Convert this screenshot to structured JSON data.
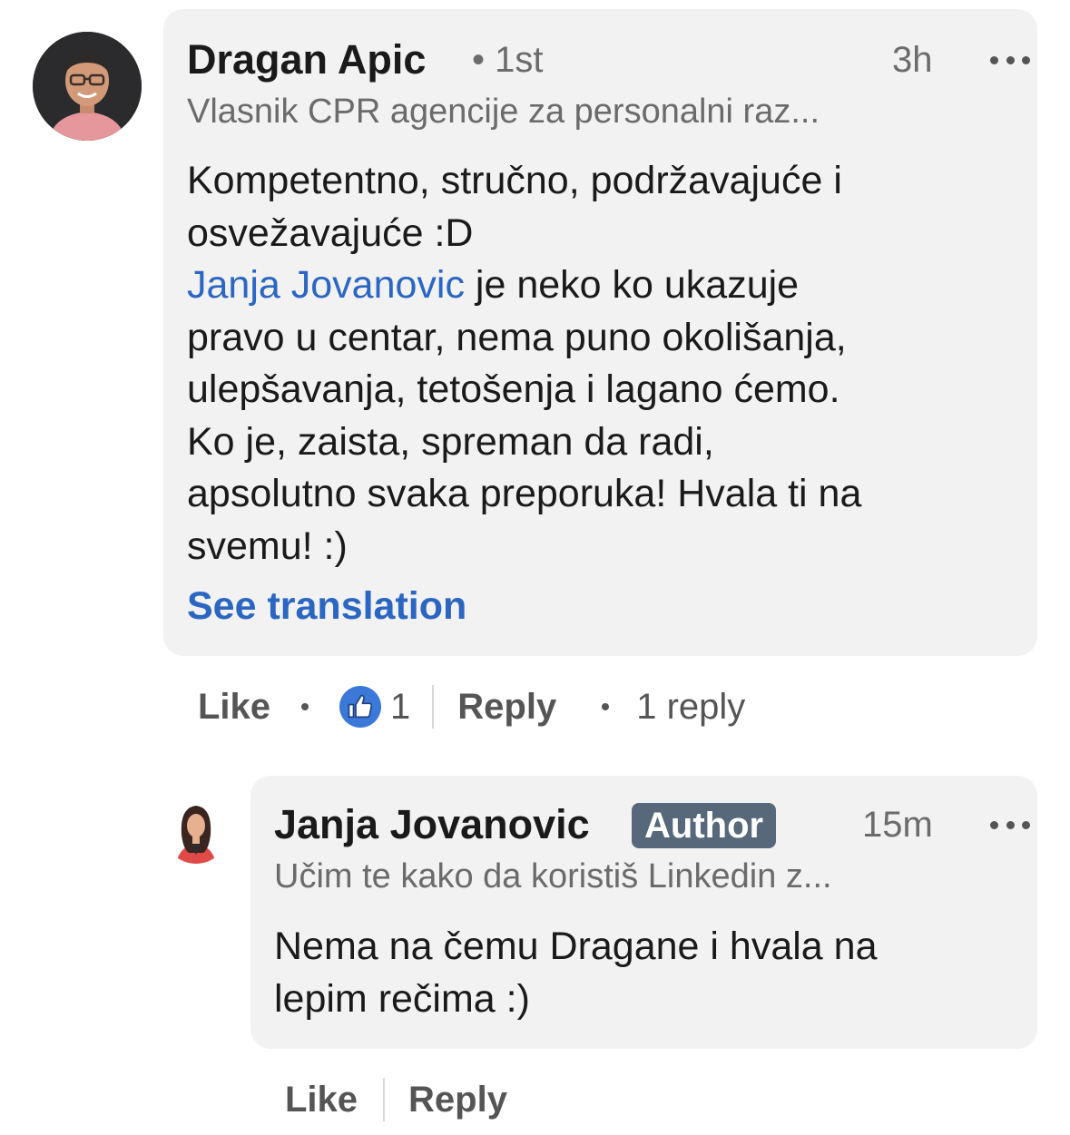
{
  "comment": {
    "author": "Dragan Apic",
    "degree": "• 1st",
    "time": "3h",
    "headline": "Vlasnik CPR agencije za personalni raz...",
    "body_line1": "Kompetentno, stručno, podržavajuće i",
    "body_line2": "osvežavajuće :D",
    "mention": "Janja Jovanovic",
    "body_rest_line3": " je neko ko ukazuje",
    "body_line4": "pravo u centar, nema puno okolišanja,",
    "body_line5": "ulepšavanja, tetošenja i lagano ćemo.",
    "body_line6": "Ko je, zaista, spreman da radi,",
    "body_line7": "apsolutno svaka preporuka! Hvala ti na",
    "body_line8": "svemu! :)",
    "see_translation": "See translation",
    "actions": {
      "like_label": "Like",
      "reaction_count": "1",
      "reply_label": "Reply",
      "replies_count": "1 reply"
    }
  },
  "reply": {
    "author": "Janja Jovanovic",
    "badge": "Author",
    "time": "15m",
    "headline": "Učim te kako da koristiš Linkedin z...",
    "body_line1": "Nema na čemu Dragane i hvala na",
    "body_line2": "lepim rečima :)",
    "actions": {
      "like_label": "Like",
      "reply_label": "Reply"
    }
  },
  "colors": {
    "bubble": "#f2f2f2",
    "link_blue": "#2a66c2",
    "badge_bg": "#56687a",
    "reaction_blue": "#3b78d8"
  },
  "icons": {
    "more": "more-horizontal-icon",
    "reaction": "thumbs-up-icon"
  }
}
